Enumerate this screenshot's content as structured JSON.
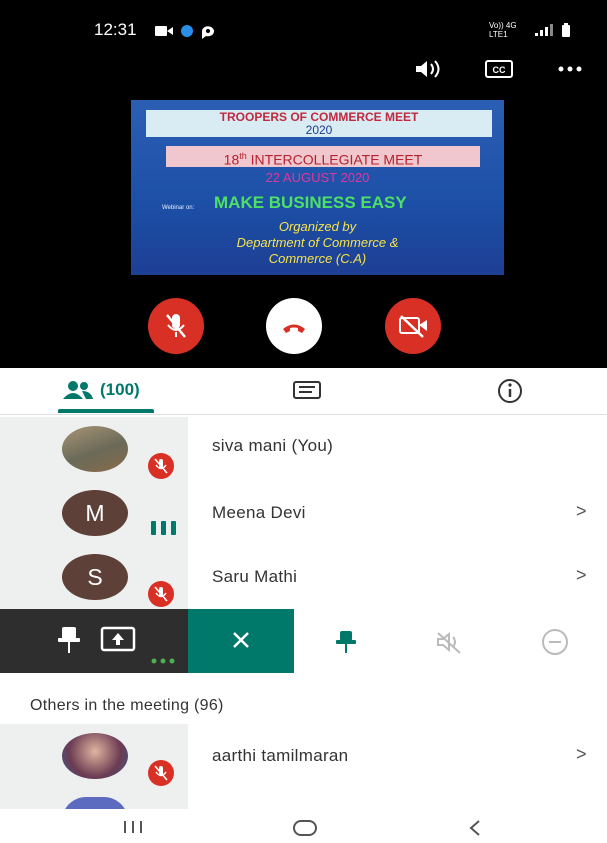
{
  "status_bar": {
    "time": "12:31",
    "network": "Vo)) 4G LTE1",
    "network_sub": "LTE1"
  },
  "slide": {
    "title_line1": "TROOPERS OF COMMERCE MEET",
    "title_line2": "2020",
    "meet_prefix": "18",
    "meet_sup": "th",
    "meet_suffix": " INTERCOLLEGIATE MEET",
    "date": "22 AUGUST 2020",
    "webinar_on": "Webinar on:",
    "main_title": "MAKE BUSINESS EASY",
    "org_line1": "Organized by",
    "org_line2": "Department of Commerce &",
    "org_line3": "Commerce (C.A)"
  },
  "tabs": {
    "people_count": "(100)"
  },
  "participants": [
    {
      "name": "siva mani (You)",
      "initial": "",
      "muted": true
    },
    {
      "name": "Meena Devi",
      "initial": "M",
      "muted": false
    },
    {
      "name": "Saru Mathi",
      "initial": "S",
      "muted": true
    }
  ],
  "others": {
    "header": "Others in the meeting (96)",
    "first_name": "aarthi tamilmaran"
  },
  "chevron": ">",
  "colors": {
    "accent": "#00796b",
    "red": "#d93025",
    "avatar_brown": "#5d4037"
  }
}
